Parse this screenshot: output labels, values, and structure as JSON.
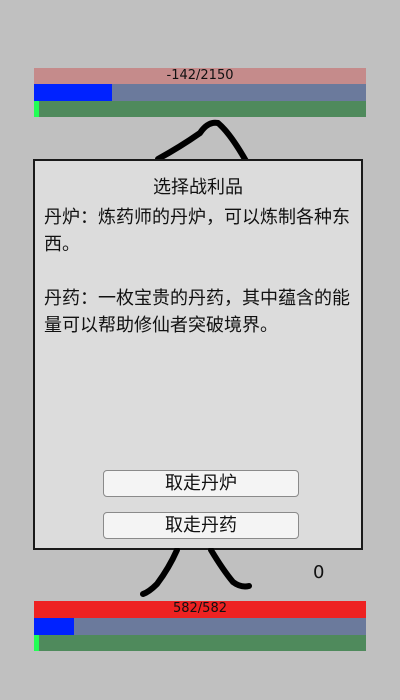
{
  "enemy": {
    "hp_text": "-142/2150",
    "mp_fraction": 0.235,
    "stamina_fraction": 0.015
  },
  "player": {
    "hp_text": "582/582",
    "mp_fraction": 0.12,
    "stamina_fraction": 0.015
  },
  "counter": "0",
  "dialog": {
    "title": "选择战利品",
    "description": "丹炉：炼药师的丹炉，可以炼制各种东西。\n\n丹药：一枚宝贵的丹药，其中蕴含的能量可以帮助修仙者突破境界。",
    "buttons": [
      "取走丹炉",
      "取走丹药"
    ]
  },
  "colors": {
    "background": "#c0c0c0",
    "enemy_hp": "#c58b8b",
    "player_hp": "#ee2222",
    "mana": "#0022ff",
    "stamina": "#22ff55"
  }
}
